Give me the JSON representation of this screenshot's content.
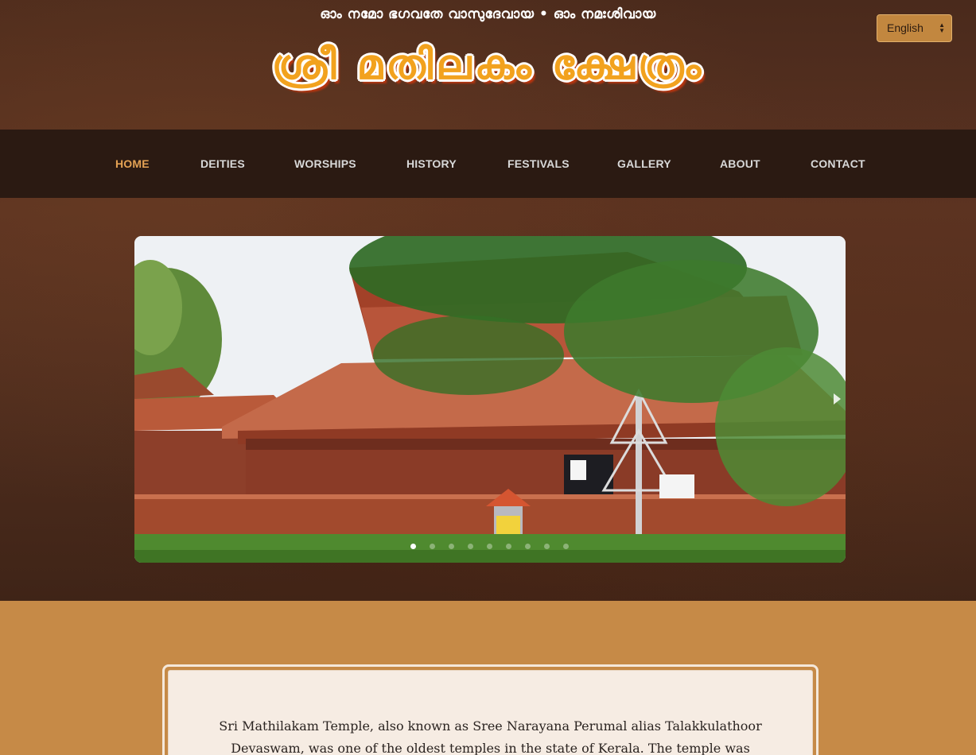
{
  "header": {
    "mantra": "ഓം നമോ ഭഗവതേ വാസുദേവായ • ഓം നമഃശിവായ",
    "site_title": "ശ്രീ മതിലകം ക്ഷേത്രം",
    "language_selected": "English"
  },
  "nav": {
    "items": [
      {
        "label": "HOME",
        "active": true
      },
      {
        "label": "DEITIES"
      },
      {
        "label": "WORSHIPS"
      },
      {
        "label": "HISTORY"
      },
      {
        "label": "FESTIVALS"
      },
      {
        "label": "GALLERY"
      },
      {
        "label": "ABOUT"
      },
      {
        "label": "CONTACT"
      }
    ]
  },
  "slider": {
    "slide_count": 9,
    "active_slide": 1
  },
  "about": {
    "text": "Sri Mathilakam Temple, also known as Sree Narayana Perumal alias Talakkulathoor Devaswam, was one of the oldest temples in the state of Kerala. The temple was destroyed by fire, fire, and"
  },
  "colors": {
    "nav_bg": "#2b1a12",
    "nav_active": "#e4a254",
    "title_orange": "#f2a21e",
    "content_bg": "#c68a47",
    "card_bg": "#f6ece3"
  },
  "icons": {
    "language_select": "up-down-chevron-icon",
    "slider_next": "chevron-right-icon"
  }
}
